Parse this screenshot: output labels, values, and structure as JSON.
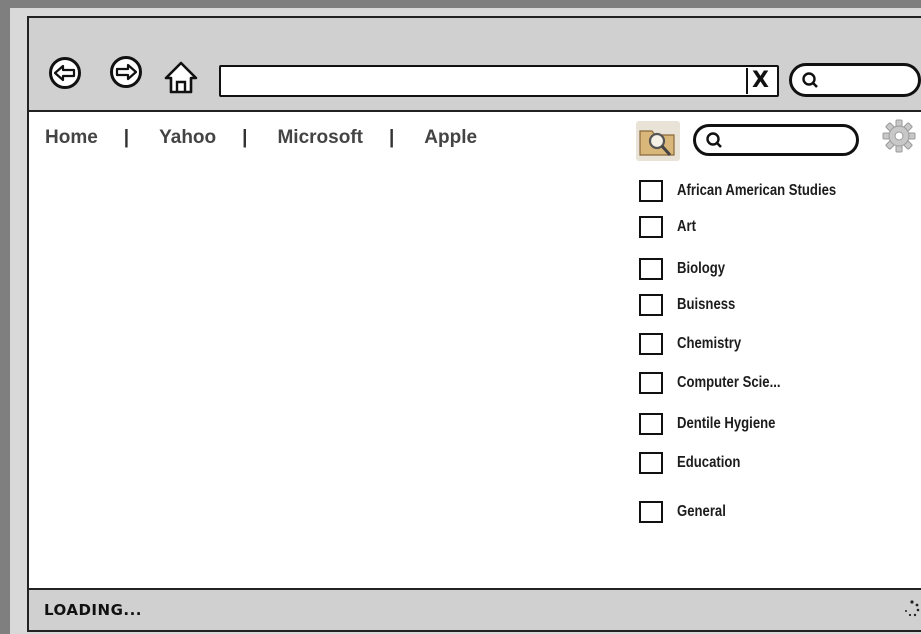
{
  "toolbar": {
    "back_icon": "back-arrow-icon",
    "forward_icon": "forward-arrow-icon",
    "home_icon": "home-icon",
    "url_value": "",
    "clear_label": "X",
    "search_icon": "search-icon"
  },
  "nav": {
    "links": [
      "Home",
      "Yahoo",
      "Microsoft",
      "Apple"
    ],
    "separator": "|"
  },
  "sidebar": {
    "search_icon": "search-icon",
    "folder_icon": "folder-search-icon",
    "gear_icon": "gear-icon",
    "categories": [
      {
        "label": "African American Studies"
      },
      {
        "label": "Art"
      },
      {
        "label": "Biology"
      },
      {
        "label": "Buisness"
      },
      {
        "label": "Chemistry"
      },
      {
        "label": "Computer Scie..."
      },
      {
        "label": "Dentile Hygiene"
      },
      {
        "label": "Education"
      },
      {
        "label": "General"
      }
    ]
  },
  "status": {
    "text": "LOADING..."
  }
}
